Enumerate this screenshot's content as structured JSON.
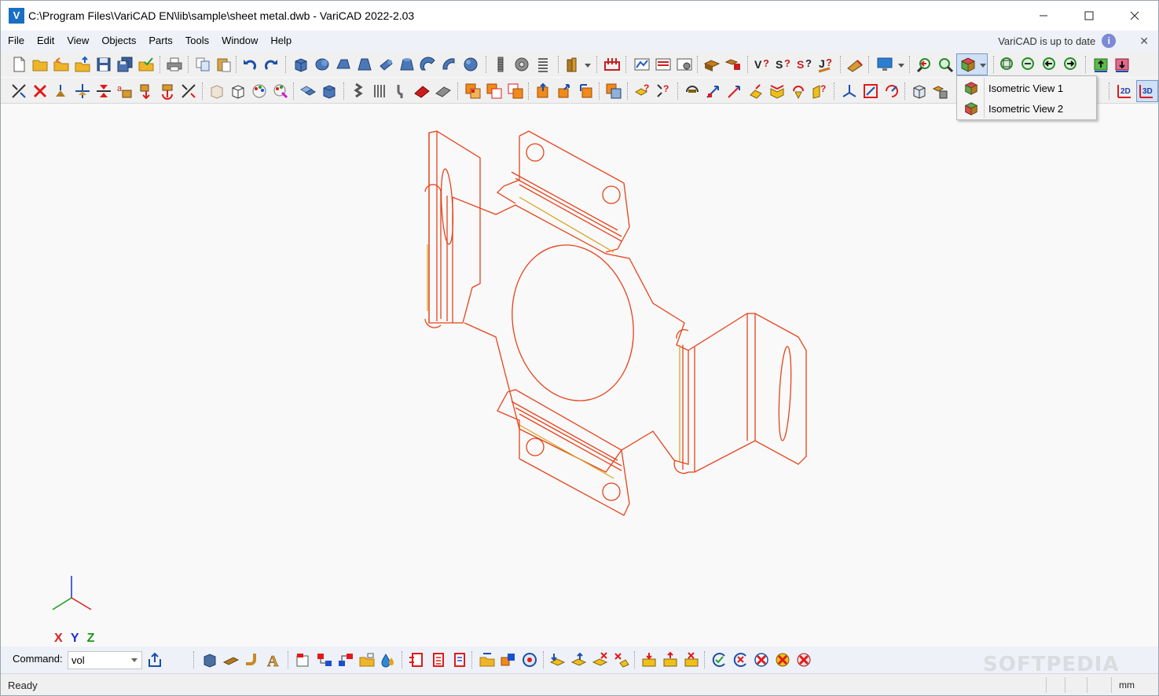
{
  "window": {
    "title": "C:\\Program Files\\VariCAD EN\\lib\\sample\\sheet metal.dwb - VariCAD 2022-2.03",
    "logo_letter": "V"
  },
  "menu": {
    "items": [
      "File",
      "Edit",
      "View",
      "Objects",
      "Parts",
      "Tools",
      "Window",
      "Help"
    ],
    "update_text": "VariCAD is up to date",
    "info_glyph": "i",
    "close_glyph": "✕"
  },
  "iso_menu": {
    "items": [
      {
        "label": "Isometric View 1"
      },
      {
        "label": "Isometric View 2"
      }
    ]
  },
  "viewport": {
    "axis_x": "X",
    "axis_y": "Y",
    "axis_z": "Z",
    "model_color": "#e8421a",
    "bend_color": "#d9a21a"
  },
  "command": {
    "label": "Command:",
    "value": "vol"
  },
  "status": {
    "text": "Ready",
    "units": "mm"
  },
  "watermark": "SOFTPEDIA"
}
